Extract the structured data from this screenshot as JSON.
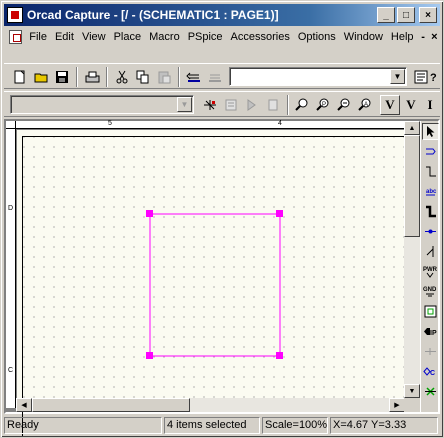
{
  "window": {
    "title": "Orcad Capture - [/ - (SCHEMATIC1 : PAGE1)]",
    "minimize_glyph": "_",
    "maximize_glyph": "□",
    "close_glyph": "×"
  },
  "menu": {
    "items": [
      "File",
      "Edit",
      "View",
      "Place",
      "Macro",
      "PSpice",
      "Accessories",
      "Options",
      "Window",
      "Help"
    ],
    "mdi_minimize_glyph": "-",
    "mdi_close_glyph": "×"
  },
  "toolbar1": {
    "buttons": [
      "new-icon",
      "open-icon",
      "save-icon",
      "print-icon",
      "cut-icon",
      "copy-icon",
      "paste-icon",
      "undo-icon",
      "redo-icon"
    ],
    "combo_value": "",
    "right_buttons": [
      "properties-icon",
      "help-icon"
    ]
  },
  "toolbar2": {
    "combo_value": "",
    "buttons": [
      "drc-icon",
      "netlist-icon",
      "annotate-icon",
      "bom-icon",
      "find-icon",
      "find-part-icon",
      "find-net-icon",
      "find-text-icon"
    ],
    "text_buttons": [
      "V",
      "V",
      "I"
    ]
  },
  "rulers": {
    "h_labels": [
      "5",
      "4"
    ],
    "v_labels": [
      "D",
      "C"
    ]
  },
  "palette": {
    "tools": [
      "select-icon",
      "place-part-icon",
      "place-wire-icon",
      "place-net-alias-icon",
      "place-bus-icon",
      "place-junction-icon",
      "place-bus-entry-icon",
      "place-power-icon",
      "place-ground-icon",
      "place-hierarchical-block-icon",
      "place-port-icon",
      "place-pin-icon",
      "place-off-page-connector-icon",
      "place-no-connect-icon"
    ],
    "tool_labels": [
      "PWR",
      "GND",
      "IP",
      "C"
    ]
  },
  "selection": {
    "color": "#ff00ff",
    "handle_color": "#ff00ff"
  },
  "status": {
    "ready": "Ready",
    "selected": "4 items selected",
    "scale": "Scale=100%",
    "coords": "X=4.67  Y=3.33"
  }
}
